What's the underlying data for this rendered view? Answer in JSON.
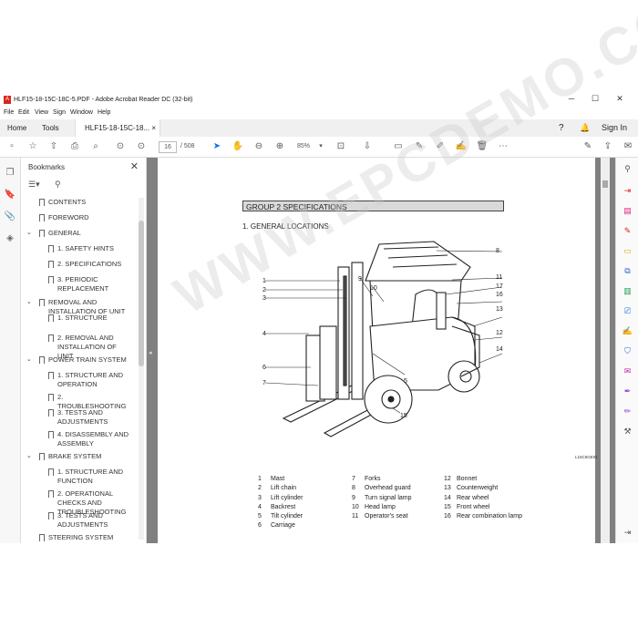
{
  "window": {
    "title": "HLF15-18-15C-18C-5.PDF - Adobe Acrobat Reader DC (32-bit)",
    "controls": [
      "─",
      "☐",
      "✕"
    ]
  },
  "menu": [
    "File",
    "Edit",
    "View",
    "Sign",
    "Window",
    "Help"
  ],
  "tabs": {
    "home": "Home",
    "tools": "Tools",
    "doc": "HLF15-18-15C-18...",
    "close": "×"
  },
  "header_right": {
    "help": "?",
    "bell": "🔔",
    "signin": "Sign In"
  },
  "toolbar": {
    "page_current": "16",
    "page_total": "/ 508",
    "zoom": "85%"
  },
  "bookmarks": {
    "title": "Bookmarks",
    "close": "✕",
    "items": [
      {
        "label": "CONTENTS",
        "level": 0
      },
      {
        "label": "FOREWORD",
        "level": 0
      },
      {
        "label": "GENERAL",
        "level": 0,
        "expanded": true
      },
      {
        "label": "1. SAFETY HINTS",
        "level": 1
      },
      {
        "label": "2. SPECIFICATIONS",
        "level": 1,
        "selected": true
      },
      {
        "label": "3. PERIODIC REPLACEMENT",
        "level": 1
      },
      {
        "label": "REMOVAL AND INSTALLATION OF UNIT",
        "level": 0,
        "expanded": true
      },
      {
        "label": "1. STRUCTURE",
        "level": 1
      },
      {
        "label": "2. REMOVAL AND INSTALLATION OF UNIT",
        "level": 1
      },
      {
        "label": "POWER TRAIN SYSTEM",
        "level": 0,
        "expanded": true
      },
      {
        "label": "1. STRUCTURE AND OPERATION",
        "level": 1
      },
      {
        "label": "2. TROUBLESHOOTING",
        "level": 1
      },
      {
        "label": "3. TESTS AND ADJUSTMENTS",
        "level": 1
      },
      {
        "label": "4. DISASSEMBLY AND ASSEMBLY",
        "level": 1
      },
      {
        "label": "BRAKE SYSTEM",
        "level": 0,
        "expanded": true
      },
      {
        "label": "1. STRUCTURE AND FUNCTION",
        "level": 1
      },
      {
        "label": "2. OPERATIONAL CHECKS AND TROUBLESHOOTING",
        "level": 1
      },
      {
        "label": "3. TESTS AND ADJUSTMENTS",
        "level": 1
      },
      {
        "label": "STEERING SYSTEM",
        "level": 0
      }
    ]
  },
  "document": {
    "group_header": "GROUP 2  SPECIFICATIONS",
    "section_title": "1. GENERAL LOCATIONS",
    "diagram_code": "L15C5GE01",
    "callouts": [
      "1",
      "2",
      "3",
      "4",
      "5",
      "6",
      "7",
      "8",
      "9",
      "10",
      "11",
      "12",
      "13",
      "14",
      "15",
      "16",
      "17"
    ],
    "legend_col1": [
      [
        "1",
        "Mast"
      ],
      [
        "2",
        "Lift chain"
      ],
      [
        "3",
        "Lift cylinder"
      ],
      [
        "4",
        "Backrest"
      ],
      [
        "5",
        "Tilt cylinder"
      ],
      [
        "6",
        "Carriage"
      ]
    ],
    "legend_col2": [
      [
        "7",
        "Forks"
      ],
      [
        "8",
        "Overhead guard"
      ],
      [
        "9",
        "Turn signal lamp"
      ],
      [
        "10",
        "Head lamp"
      ],
      [
        "11",
        "Operator's seat"
      ]
    ],
    "legend_col3": [
      [
        "12",
        "Bonnet"
      ],
      [
        "13",
        "Counterweight"
      ],
      [
        "14",
        "Rear wheel"
      ],
      [
        "15",
        "Front wheel"
      ],
      [
        "16",
        "Rear combination lamp"
      ]
    ]
  },
  "watermark": "WWW.EPCDEMO.COM",
  "colors": {
    "accent": "#1473e6",
    "acrobat_red": "#d8271c",
    "doc_bg": "#808080"
  }
}
